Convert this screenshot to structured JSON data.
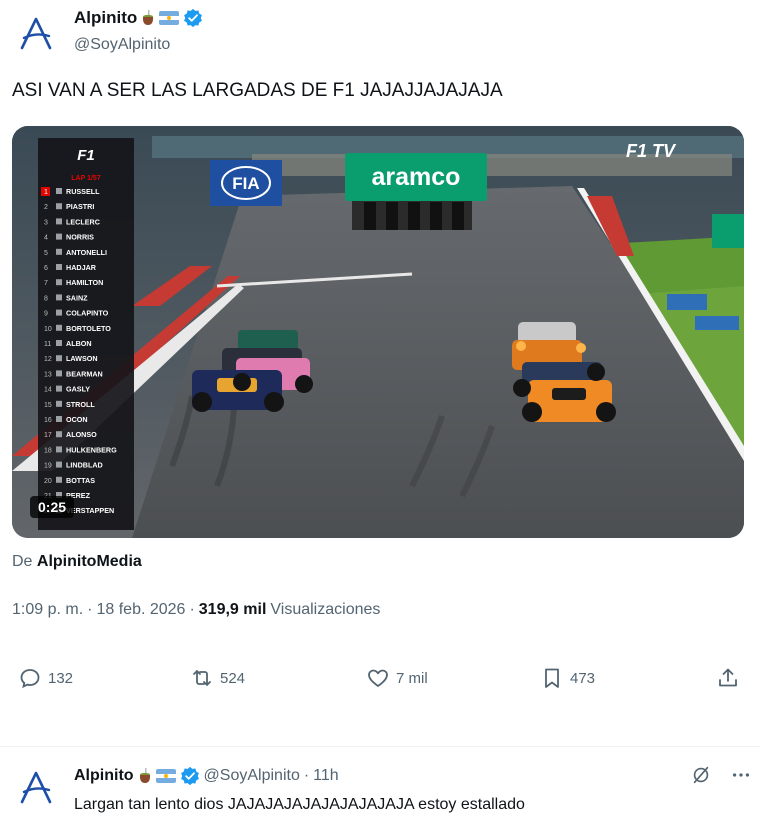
{
  "tweet": {
    "author_name": "Alpinito",
    "handle": "@SoyAlpinito",
    "text": "ASI VAN A SER LAS LARGADAS DE F1 JAJAJJAJAJAJA",
    "video_time": "0:25",
    "from_prefix": "De",
    "from_source": "AlpinitoMedia",
    "time": "1:09 p. m.",
    "date": "18 feb. 2026",
    "views_count": "319,9 mil",
    "views_label": "Visualizaciones",
    "replies": "132",
    "retweets": "524",
    "likes": "7 mil",
    "bookmarks": "473"
  },
  "video": {
    "f1tv_label": "F1 TV",
    "fia_label": "FIA",
    "sponsor_label": "aramco",
    "leaderboard": [
      "RUSSELL",
      "PIASTRI",
      "LECLERC",
      "NORRIS",
      "ANTONELLI",
      "HADJAR",
      "HAMILTON",
      "SAINZ",
      "COLAPINTO",
      "BORTOLETO",
      "ALBON",
      "LAWSON",
      "BEARMAN",
      "GASLY",
      "STROLL",
      "OCON",
      "ALONSO",
      "HULKENBERG",
      "LINDBLAD",
      "BOTTAS",
      "PEREZ",
      "VERSTAPPEN"
    ]
  },
  "reply": {
    "author_name": "Alpinito",
    "handle": "@SoyAlpinito",
    "age": "11h",
    "text": "Largan tan lento dios JAJAJAJAJAJAJAJAJAJA estoy estallado"
  },
  "colors": {
    "verified": "#1d9bf0",
    "avatar_blue": "#1d4fa8",
    "muted": "#536471"
  }
}
